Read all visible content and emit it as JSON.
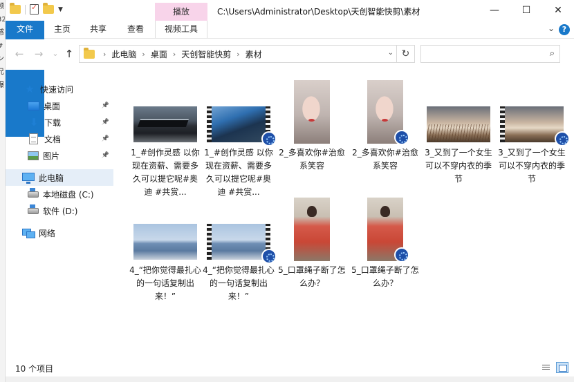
{
  "window": {
    "title_path": "C:\\Users\\Administrator\\Desktop\\天创智能快剪\\素材",
    "context_tab": "播放",
    "controls": {
      "minimize": "—",
      "maximize": "☐",
      "close": "✕"
    }
  },
  "background_strip": [
    "频",
    "",
    "",
    "",
    "",
    "",
    "32",
    "",
    "",
    "",
    "",
    "",
    "",
    "",
    "",
    "",
    "",
    "感",
    "",
    "#",
    "ン",
    "",
    "兄",
    "",
    "爆"
  ],
  "ribbon": {
    "tabs": [
      "文件",
      "主页",
      "共享",
      "查看",
      "视频工具"
    ],
    "chevron": "⌄",
    "help": "?"
  },
  "navigation": {
    "back": "←",
    "forward": "→",
    "recent": "⌄",
    "up": "↑",
    "breadcrumbs": [
      "此电脑",
      "桌面",
      "天创智能快剪",
      "素材"
    ],
    "refresh": "↻",
    "search_placeholder": "",
    "search_icon": "⌕"
  },
  "sidebar": {
    "items": [
      {
        "label": "快速访问",
        "icon": "star-icon",
        "pinned": false
      },
      {
        "label": "桌面",
        "icon": "desktop-icon",
        "pinned": true
      },
      {
        "label": "下载",
        "icon": "download-icon",
        "pinned": true
      },
      {
        "label": "文档",
        "icon": "document-icon",
        "pinned": true
      },
      {
        "label": "图片",
        "icon": "pictures-icon",
        "pinned": true
      },
      {
        "label": "此电脑",
        "icon": "computer-icon",
        "pinned": false,
        "selected": true
      },
      {
        "label": "本地磁盘 (C:)",
        "icon": "disk-icon",
        "pinned": false
      },
      {
        "label": "软件 (D:)",
        "icon": "disk-icon",
        "pinned": false
      },
      {
        "label": "网络",
        "icon": "network-icon",
        "pinned": false
      }
    ]
  },
  "files": [
    {
      "name": "1_#创作灵感 以你现在资薪、需要多久可以提它呢#奥迪 #共赏...",
      "thumb": "car",
      "kind": "image"
    },
    {
      "name": "1_#创作灵感 以你现在资薪、需要多久可以提它呢#奥迪 #共赏...",
      "thumb": "carblue",
      "kind": "video"
    },
    {
      "name": "2_多喜欢你#治愈系笑容",
      "thumb": "face",
      "kind": "image"
    },
    {
      "name": "2_多喜欢你#治愈系笑容",
      "thumb": "face",
      "kind": "video"
    },
    {
      "name": "3_又到了一个女生可以不穿内衣的季节",
      "thumb": "reeds",
      "kind": "image"
    },
    {
      "name": "3_又到了一个女生可以不穿内衣的季节",
      "thumb": "reeds",
      "kind": "video"
    },
    {
      "name": "4_“把你觉得最扎心的一句话复制出来！”",
      "thumb": "sea",
      "kind": "image"
    },
    {
      "name": "4_“把你觉得最扎心的一句话复制出来！”",
      "thumb": "sea",
      "kind": "video"
    },
    {
      "name": "5_口罩绳子断了怎么办？",
      "thumb": "red",
      "kind": "image"
    },
    {
      "name": "5_口罩绳子断了怎么办？",
      "thumb": "red",
      "kind": "video"
    }
  ],
  "status": {
    "item_count": "10 个项目"
  }
}
